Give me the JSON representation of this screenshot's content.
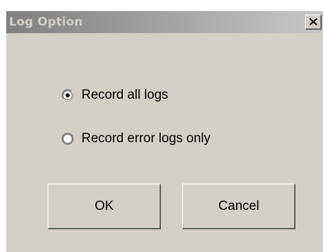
{
  "window": {
    "title": "Log Option",
    "close_icon": "close-icon"
  },
  "options": [
    {
      "label": "Record all logs",
      "selected": true
    },
    {
      "label": "Record error logs only",
      "selected": false
    }
  ],
  "buttons": {
    "ok_label": "OK",
    "cancel_label": "Cancel"
  },
  "colors": {
    "face": "#d4d0c8",
    "titlebar_start": "#808080",
    "titlebar_end": "#c8c8c8"
  }
}
